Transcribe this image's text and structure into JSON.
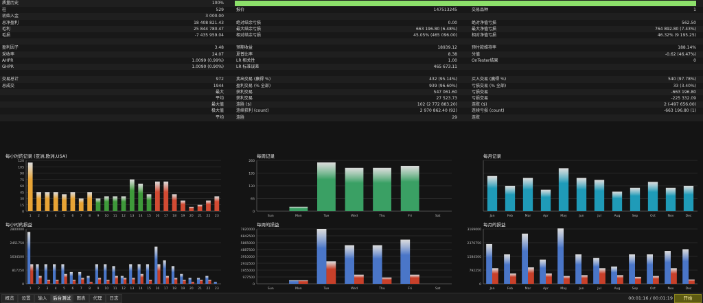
{
  "stats": {
    "history_quality": {
      "label": "质量历史",
      "value": "100%",
      "bar_fraction": 1.0,
      "bar_color": "#8ce06a"
    },
    "rows": [
      {
        "c0": [
          "柱",
          "529"
        ],
        "c1": [
          "报价",
          "147513245"
        ],
        "c2": [
          "交易品种",
          "1"
        ]
      },
      {
        "c0": [
          "初始入金",
          "3 000.00"
        ],
        "c1": [
          "",
          ""
        ],
        "c2": [
          "",
          ""
        ]
      },
      {
        "c0": [
          "总净盈利",
          "18 408 821.43"
        ],
        "c1": [
          "绝对结余亏损",
          "0.00"
        ],
        "c2": [
          "绝对净值亏损",
          "562.50"
        ]
      },
      {
        "c0": [
          "毛利",
          "25 844 780.47"
        ],
        "c1": [
          "最大结余亏损",
          "663 196.80 (6.48%)"
        ],
        "c2": [
          "最大净值亏损",
          "764 892.80 (7.43%)"
        ]
      },
      {
        "c0": [
          "毛损",
          "-7 435 959.04"
        ],
        "c1": [
          "相对结余亏损",
          "45.05% (465 096.00)"
        ],
        "c2": [
          "相对净值亏损",
          "46.32% (9 195.25)"
        ]
      },
      {
        "c0": [
          "",
          ""
        ],
        "c1": [
          "",
          ""
        ],
        "c2": [
          "",
          ""
        ]
      },
      {
        "c0": [
          "盈利因子",
          "3.48"
        ],
        "c1": [
          "预期收益",
          "18939.12"
        ],
        "c2": [
          "预付款维持率",
          "188.14%"
        ]
      },
      {
        "c0": [
          "采收率",
          "24.07"
        ],
        "c1": [
          "夏普比率",
          "8.38"
        ],
        "c2": [
          "分值",
          "-0.62 (46.47%)"
        ]
      },
      {
        "c0": [
          "AHPR",
          "1.0099 (0.99%)"
        ],
        "c1": [
          "LR 相关性",
          "1.00"
        ],
        "c2": [
          "OnTester结果",
          "0"
        ]
      },
      {
        "c0": [
          "GHPR",
          "1.0090 (0.90%)"
        ],
        "c1": [
          "LR 标准误差",
          "465 673.11"
        ],
        "c2": [
          "",
          ""
        ]
      },
      {
        "c0": [
          "",
          ""
        ],
        "c1": [
          "",
          ""
        ],
        "c2": [
          "",
          ""
        ]
      },
      {
        "c0": [
          "交易总计",
          "972"
        ],
        "c1": [
          "卖出交易 (赢得 %)",
          "432 (95.14%)"
        ],
        "c2": [
          "买入交易 (赢得 %)",
          "540 (97.78%)"
        ]
      },
      {
        "c0": [
          "总成交",
          "1944"
        ],
        "c1": [
          "盈利交易 (% 全部)",
          "939 (96.60%)"
        ],
        "c2": [
          "亏损交易 (% 全部)",
          "33 (3.40%)"
        ]
      },
      {
        "c0": [
          "最大",
          ""
        ],
        "c1": [
          "获利交易",
          "547 061.60"
        ],
        "c2": [
          "亏损交易",
          "-663 196.80"
        ]
      },
      {
        "c0": [
          "平均",
          ""
        ],
        "c1": [
          "获利交易",
          "27 523.73"
        ],
        "c2": [
          "亏损交易",
          "-225 332.09"
        ]
      },
      {
        "c0": [
          "最大值",
          ""
        ],
        "c1": [
          "连胜 ($)",
          "102 (2 772 883.20)"
        ],
        "c2": [
          "连败 ($)",
          "2 (-497 656.00)"
        ]
      },
      {
        "c0": [
          "极大值",
          ""
        ],
        "c1": [
          "连续获利 (count)",
          "2 970 862.40 (92)"
        ],
        "c2": [
          "连续亏损 (count)",
          "-663 196.80 (1)"
        ]
      },
      {
        "c0": [
          "平均",
          ""
        ],
        "c1": [
          "连胜",
          "29"
        ],
        "c2": [
          "连败",
          ""
        ]
      }
    ]
  },
  "chart_data": [
    {
      "type": "bar",
      "title": "每小时的记录 (亚洲,欧洲,USA)",
      "categories": [
        "1",
        "2",
        "3",
        "4",
        "5",
        "6",
        "7",
        "8",
        "9",
        "10",
        "11",
        "12",
        "13",
        "14",
        "15",
        "16",
        "17",
        "18",
        "19",
        "20",
        "21",
        "22",
        "23"
      ],
      "values": [
        115,
        45,
        45,
        45,
        40,
        45,
        30,
        45,
        30,
        35,
        35,
        35,
        75,
        65,
        40,
        70,
        70,
        40,
        25,
        10,
        15,
        25,
        35
      ],
      "bar_colors": [
        "#e8a435",
        "#e8a435",
        "#e8a435",
        "#e8a435",
        "#e8a435",
        "#e8a435",
        "#e8a435",
        "#e8a435",
        "#3e9a3a",
        "#3e9a3a",
        "#3e9a3a",
        "#3e9a3a",
        "#3e9a3a",
        "#3e9a3a",
        "#3e9a3a",
        "#d24b33",
        "#d24b33",
        "#d24b33",
        "#d24b33",
        "#d24b33",
        "#d24b33",
        "#d24b33",
        "#d24b33"
      ],
      "yticks": [
        "120",
        "105",
        "90",
        "75",
        "60",
        "45",
        "30",
        "15",
        "0"
      ],
      "ylim": [
        0,
        120
      ]
    },
    {
      "type": "bar",
      "title": "每周记录",
      "categories": [
        "Sun",
        "Mon",
        "Tue",
        "Wed",
        "Thu",
        "Fri",
        "Sat"
      ],
      "values": [
        0,
        22,
        250,
        222,
        222,
        232,
        0
      ],
      "bar_colors": [
        "#3aa064"
      ],
      "yticks": [
        "260",
        "195",
        "130",
        "65",
        "0"
      ],
      "ylim": [
        0,
        260
      ]
    },
    {
      "type": "bar",
      "title": "每月记录",
      "categories": [
        "Jan",
        "Feb",
        "Mar",
        "Apr",
        "May",
        "Jun",
        "Jul",
        "Aug",
        "Sep",
        "Oct",
        "Nov",
        "Dec"
      ],
      "values": [
        90,
        65,
        85,
        55,
        110,
        85,
        80,
        50,
        60,
        75,
        60,
        65
      ],
      "bar_colors": [
        "#1f9bb8"
      ],
      "yticks": [],
      "ylim": [
        0,
        130
      ]
    },
    {
      "type": "bar",
      "title": "每小时的损益",
      "categories": [
        "1",
        "2",
        "3",
        "4",
        "5",
        "6",
        "7",
        "8",
        "9",
        "10",
        "11",
        "12",
        "13",
        "14",
        "15",
        "16",
        "17",
        "18",
        "19",
        "20",
        "21",
        "22",
        "23"
      ],
      "series": [
        {
          "values": [
            2650000,
            1000000,
            1000000,
            1000000,
            1000000,
            600000,
            600000,
            400000,
            1000000,
            1000000,
            900000,
            400000,
            1000000,
            1000000,
            1000000,
            1900000,
            1200000,
            900000,
            500000,
            300000,
            300000,
            400000,
            100000
          ]
        },
        {
          "values": [
            1000000,
            400000,
            200000,
            200000,
            500000,
            200000,
            300000,
            100000,
            300000,
            200000,
            400000,
            300000,
            300000,
            500000,
            200000,
            1000000,
            400000,
            300000,
            200000,
            100000,
            200000,
            200000,
            0
          ]
        }
      ],
      "series_colors": [
        "#4a76c8",
        "#c8402a"
      ],
      "yticks": [
        "2800000",
        "2451750",
        "1634500",
        "817250",
        "0"
      ],
      "ylim": [
        0,
        2800000
      ]
    },
    {
      "type": "bar",
      "title": "每周的损益",
      "categories": [
        "Sun",
        "Mon",
        "Tue",
        "Wed",
        "Thu",
        "Fri",
        "Sat"
      ],
      "series": [
        {
          "values": [
            0,
            500000,
            7820000,
            5500000,
            5500000,
            6300000,
            0
          ]
        },
        {
          "values": [
            0,
            500000,
            3200000,
            1300000,
            900000,
            1300000,
            0
          ]
        }
      ],
      "series_colors": [
        "#4a76c8",
        "#c8402a"
      ],
      "yticks": [
        "7820000",
        "6842500",
        "5865000",
        "4887500",
        "3910000",
        "2932500",
        "1955000",
        "977500",
        "0"
      ],
      "ylim": [
        0,
        7820000
      ]
    },
    {
      "type": "bar",
      "title": "每月的损益",
      "categories": [
        "Jan",
        "Feb",
        "Mar",
        "Apr",
        "May",
        "Jun",
        "Jul",
        "Aug",
        "Sep",
        "Oct",
        "Nov",
        "Dec"
      ],
      "series": [
        {
          "values": [
            2300000,
            1700000,
            2900000,
            1400000,
            3200000,
            1700000,
            1500000,
            1000000,
            1700000,
            1700000,
            1900000,
            2000000
          ]
        },
        {
          "values": [
            900000,
            600000,
            950000,
            600000,
            450000,
            500000,
            900000,
            500000,
            400000,
            450000,
            900000,
            250000
          ]
        }
      ],
      "series_colors": [
        "#4a76c8",
        "#c8402a"
      ],
      "yticks": [
        "3169000",
        "2376750",
        "1584500",
        "792250",
        "0"
      ],
      "ylim": [
        0,
        3169000
      ]
    }
  ],
  "tabs": [
    "概览",
    "设置",
    "输入",
    "后台测试",
    "图表",
    "代理",
    "日志"
  ],
  "active_tab": 3,
  "elapsed_time": "00:01:16 / 00:01:19",
  "start_label": "开始"
}
